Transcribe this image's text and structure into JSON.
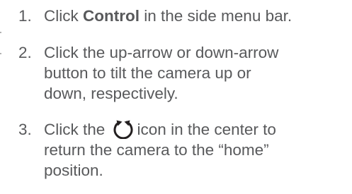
{
  "steps": [
    {
      "number": "1.",
      "text_before": "Click ",
      "emphasis": "Control",
      "text_after": " in the side menu bar."
    },
    {
      "number": "2.",
      "lines": [
        "Click the up-arrow or down-arrow",
        "button to tilt the camera up or",
        "down, respectively."
      ]
    },
    {
      "number": "3.",
      "line1_before_icon": "Click the",
      "line1_after_icon": "icon in the center to",
      "icon": "home-position-icon",
      "lines_after": [
        "return the camera to the “home”",
        "position."
      ]
    }
  ],
  "colors": {
    "text": "#58595b",
    "icon": "#231f20"
  }
}
